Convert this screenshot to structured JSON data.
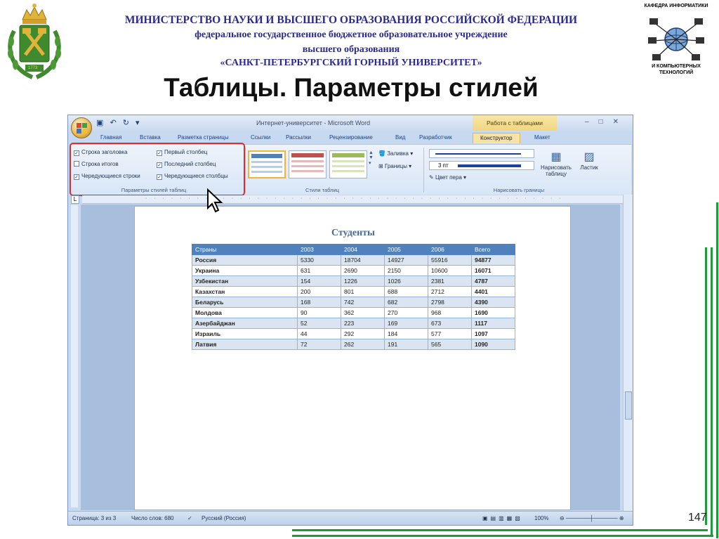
{
  "header": {
    "ministry": "МИНИСТЕРСТВО НАУКИ И ВЫСШЕГО ОБРАЗОВАНИЯ РОССИЙСКОЙ ФЕДЕРАЦИИ",
    "institution_type": "федеральное государственное бюджетное образовательное учреждение",
    "education_level": "высшего образования",
    "university": "«САНКТ-ПЕТЕРБУРГСКИЙ ГОРНЫЙ УНИВЕРСИТЕТ»",
    "slide_title": "Таблицы. Параметры стилей"
  },
  "dept_logo": {
    "top": "КАФЕДРА ИНФОРМАТИКИ",
    "bottom": "И КОМПЬЮТЕРНЫХ ТЕХНОЛОГИЙ"
  },
  "emblem_year": "1773",
  "page_number": "147",
  "word": {
    "window_title": "Интернет-университет - Microsoft Word",
    "context_title": "Работа с таблицами",
    "tabs": [
      "Главная",
      "Вставка",
      "Разметка страницы",
      "Ссылки",
      "Рассылки",
      "Рецензирование",
      "Вид",
      "Разработчик",
      "Конструктор",
      "Макет"
    ],
    "style_options": {
      "header_row": "Строка заголовка",
      "total_row": "Строка итогов",
      "banded_rows": "Чередующиеся строки",
      "first_column": "Первый столбец",
      "last_column": "Последний столбец",
      "banded_columns": "Чередующиеся столбцы",
      "group_label": "Параметры стилей таблиц"
    },
    "table_styles_label": "Стили таблиц",
    "shading": "Заливка",
    "borders": "Границы",
    "pen_weight": "3 пт",
    "pen_color": "Цвет пера",
    "draw_table": "Нарисовать таблицу",
    "eraser": "Ластик",
    "draw_borders_label": "Нарисовать границы",
    "status": {
      "page": "Страница: 3 из 3",
      "words": "Число слов: 680",
      "language": "Русский (Россия)",
      "zoom": "100%"
    }
  },
  "document": {
    "title": "Студенты",
    "columns": [
      "Страны",
      "2003",
      "2004",
      "2005",
      "2006",
      "Всего"
    ],
    "rows": [
      [
        "Россия",
        "5330",
        "18704",
        "14927",
        "55916",
        "94877"
      ],
      [
        "Украина",
        "631",
        "2690",
        "2150",
        "10600",
        "16071"
      ],
      [
        "Узбекистан",
        "154",
        "1226",
        "1026",
        "2381",
        "4787"
      ],
      [
        "Казахстан",
        "200",
        "801",
        "688",
        "2712",
        "4401"
      ],
      [
        "Беларусь",
        "168",
        "742",
        "682",
        "2798",
        "4390"
      ],
      [
        "Молдова",
        "90",
        "362",
        "270",
        "968",
        "1690"
      ],
      [
        "Азербайджан",
        "52",
        "223",
        "169",
        "673",
        "1117"
      ],
      [
        "Израиль",
        "44",
        "292",
        "184",
        "577",
        "1097"
      ],
      [
        "Латвия",
        "72",
        "262",
        "191",
        "565",
        "1090"
      ]
    ]
  },
  "colors": {
    "header_text": "#2a2a8a",
    "accent_green": "#1f9a3a",
    "table_header": "#4f81bd",
    "highlight_box": "#d83030"
  }
}
